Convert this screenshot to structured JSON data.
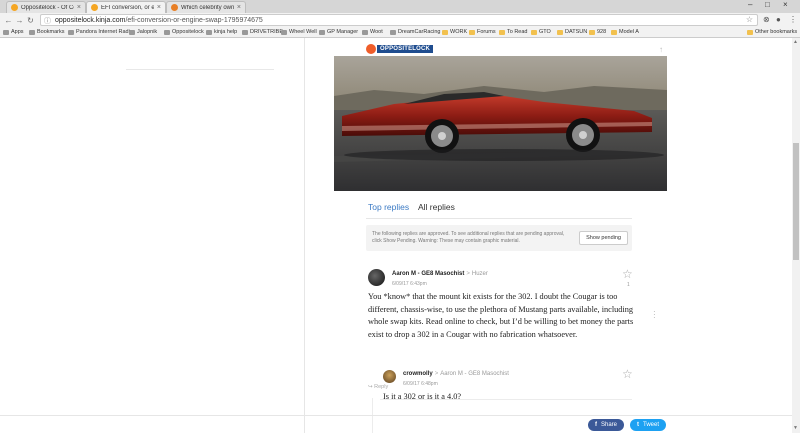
{
  "tabs": [
    {
      "label": "Oppositelock - Of Coun",
      "close": "×"
    },
    {
      "label": "EFI conversion, or engin",
      "close": "×",
      "active": true
    },
    {
      "label": "Which celebrity owned",
      "close": "×"
    }
  ],
  "toolbar": {
    "url_host": "oppositelock.kinja.com",
    "url_path": "/efi-conversion-or-engine-swap-1795974675",
    "back": "←",
    "forward": "→",
    "reload": "↻"
  },
  "bookmarks": [
    {
      "label": "Apps",
      "icon": "apps-icon"
    },
    {
      "label": "Bookmarks",
      "icon": "star-icon"
    },
    {
      "label": "Pandora Internet Radi",
      "icon": "pandora-icon"
    },
    {
      "label": "Jalopnik",
      "icon": "jalopnik-icon"
    },
    {
      "label": "Oppositelock",
      "icon": "oppositelock-icon"
    },
    {
      "label": "kinja help",
      "icon": "kinja-icon"
    },
    {
      "label": "DRIVETRIBE",
      "icon": "drivetribe-icon"
    },
    {
      "label": "Wheel Well",
      "icon": "wheel-icon"
    },
    {
      "label": "GP Manager",
      "icon": "gp-icon"
    },
    {
      "label": "Woot",
      "icon": "woot-icon"
    },
    {
      "label": "DreamCarRacing",
      "icon": "dcr-icon"
    },
    {
      "label": "WORK",
      "icon": "folder-icon"
    },
    {
      "label": "Forums",
      "icon": "folder-icon"
    },
    {
      "label": "To Read",
      "icon": "folder-icon"
    },
    {
      "label": "GTO",
      "icon": "folder-icon"
    },
    {
      "label": "DATSUN",
      "icon": "folder-icon"
    },
    {
      "label": "928",
      "icon": "folder-icon"
    },
    {
      "label": "Model A",
      "icon": "folder-icon"
    }
  ],
  "other_bookmarks": "Other bookmarks",
  "site": {
    "logo_text": "OPPOSITELOCK"
  },
  "replies": {
    "top_label": "Top replies",
    "all_label": "All replies",
    "pending_text": "The following replies are approved. To see additional replies that are pending approval, click Show Pending. Warning: These may contain graphic material.",
    "pending_button": "Show pending"
  },
  "comments": [
    {
      "author": "Aaron M - GE8 Masochist",
      "to": "Huzer",
      "date": "6/09/17 6:43pm",
      "body": "You *know* that the mount kit exists for the 302. I doubt the Cougar is too different, chassis-wise, to use the plethora of Mustang parts available, including whole swap kits. Read online to check, but I’d be willing to bet money the parts exist to drop a 302 in a Cougar with no fabrication whatsoever.",
      "stars": "1",
      "reply_label": "Reply"
    },
    {
      "author": "crowmolly",
      "to": "Aaron M - GE8 Masochist",
      "date": "6/09/17 6:48pm",
      "body": "Is it a 302 or is it a 4.0?"
    }
  ],
  "share": {
    "facebook": "Share",
    "twitter": "Tweet"
  },
  "colors": {
    "accent": "#3b7ac4",
    "facebook": "#3b5998",
    "twitter": "#1da1f2",
    "logo_orange": "#ef5d2a",
    "logo_blue": "#1f4d8f"
  }
}
